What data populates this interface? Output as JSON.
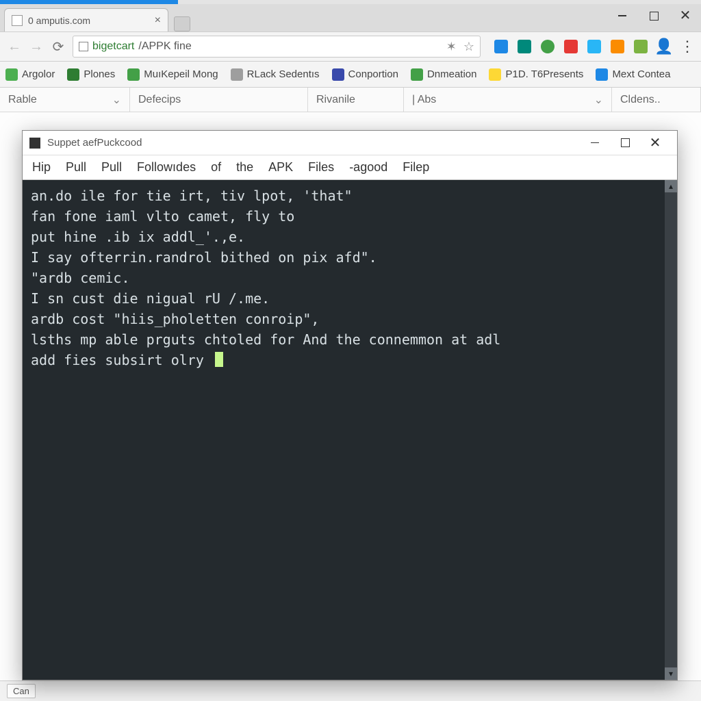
{
  "browser": {
    "tab_title": "0 amputis.com",
    "url_prefix": "bigetcart",
    "url_rest": "/APPK fine",
    "window_controls": {
      "min": "−",
      "max": "☐",
      "close": "✕"
    }
  },
  "bookmarks": [
    {
      "label": "Argolor"
    },
    {
      "label": "Plones"
    },
    {
      "label": "MuıKepeil Mong"
    },
    {
      "label": "RLack Sedentıs"
    },
    {
      "label": "Conportion"
    },
    {
      "label": "Dnmeation"
    },
    {
      "label": "P1D. T6Presents"
    },
    {
      "label": "Mext Contea"
    }
  ],
  "columns": {
    "c1": "Rable",
    "c2": "Defecips",
    "c3": "Rivanile",
    "c4": "| Abs",
    "c5": "Cldens.."
  },
  "statusbar": {
    "label": "Can"
  },
  "terminal": {
    "title": "Suppet aefPuckcood",
    "menu": [
      "Hip",
      "Pull",
      "Pull",
      "Followıdes",
      "of",
      "the",
      "APK",
      "Files",
      "-agood",
      "Filep"
    ],
    "lines": [
      "an.do ile for tie irt, tiv lpot, 'that\"",
      "fan fone iaml vlto camet, fly to",
      "put hine .ib ix addl_'.,e.",
      "I say ofterrin.randrol bithed on pix afd\".",
      "\"ardb cemic.",
      "I sn cust die nigual rU /.me.",
      "ardb cost \"hiis_pholetten conroip\",",
      "lsths mp able prguts chtoled for And the connemmon at adl",
      "add fies subsirt olry "
    ]
  }
}
